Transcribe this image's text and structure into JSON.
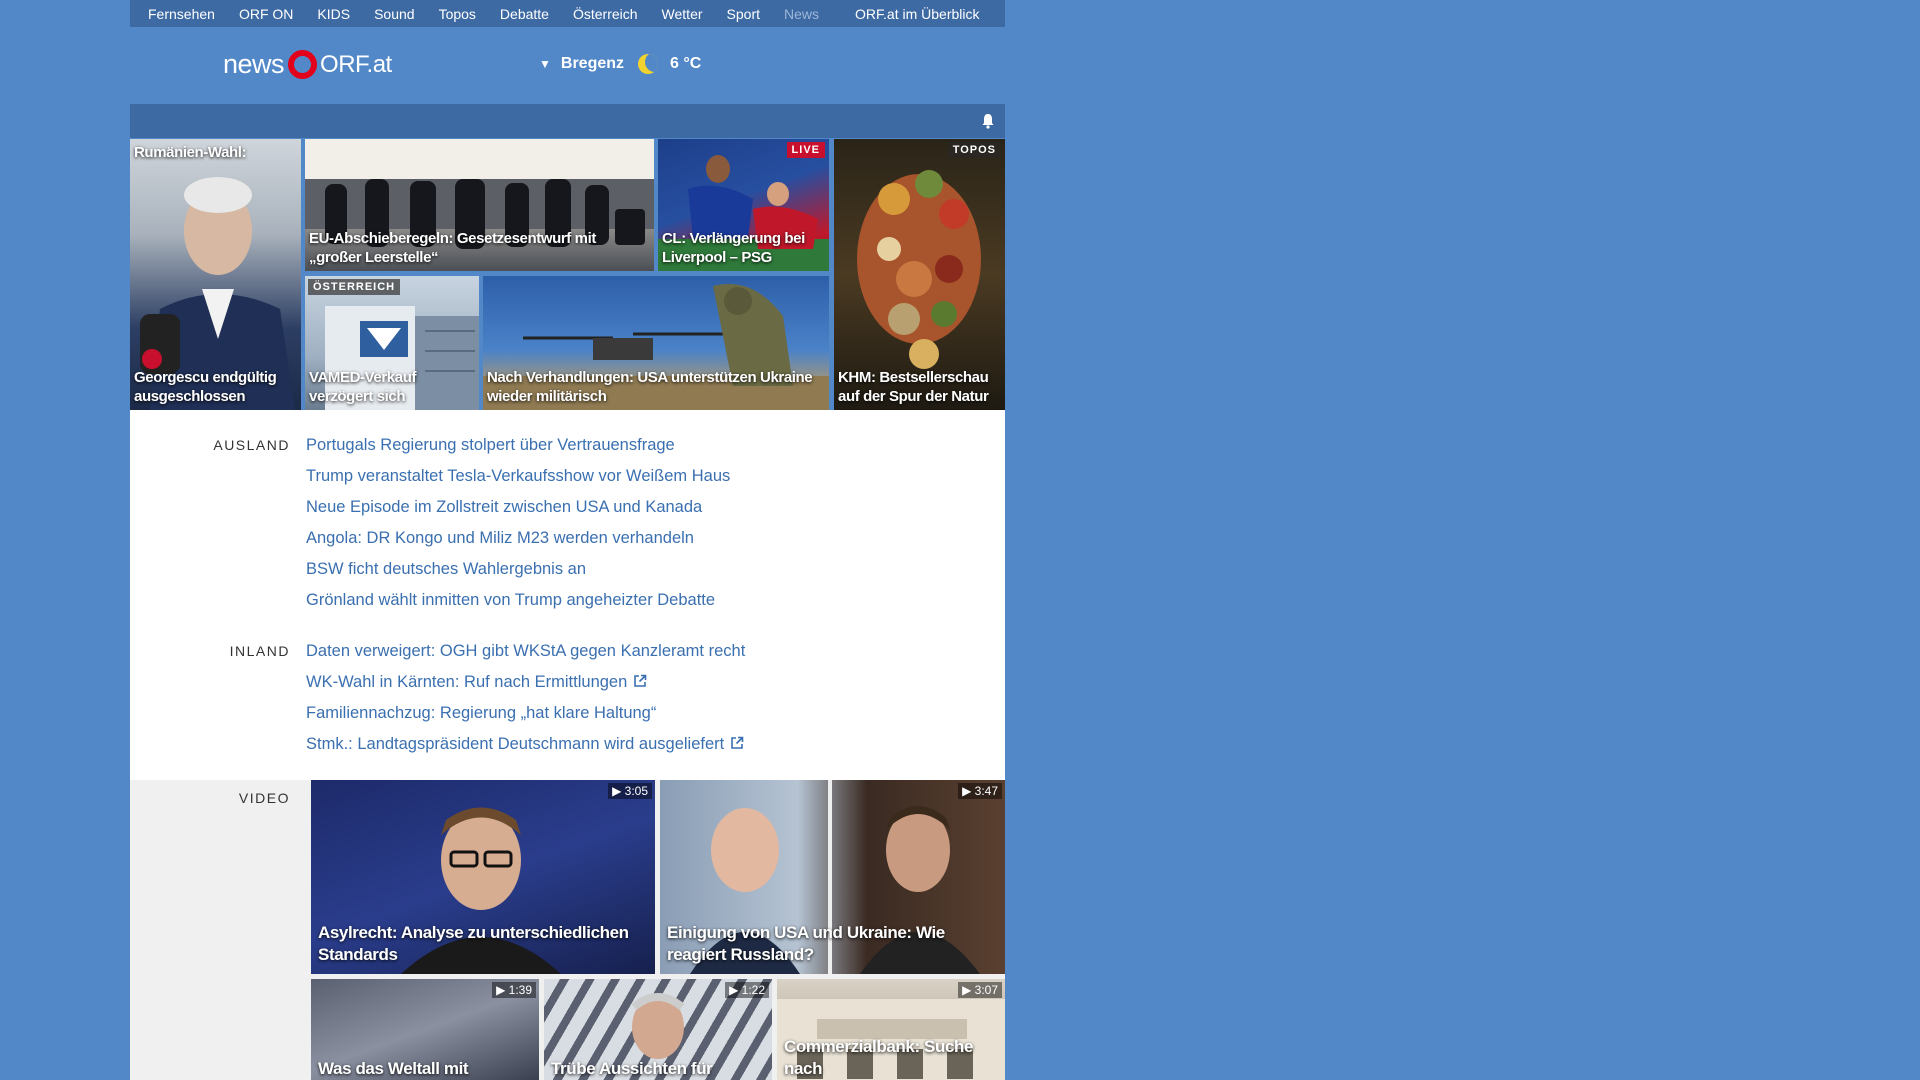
{
  "topnav": {
    "items": [
      "Fernsehen",
      "ORF ON",
      "KIDS",
      "Sound",
      "Topos",
      "Debatte",
      "Österreich",
      "Wetter",
      "Sport",
      "News"
    ],
    "overview": "ORF.at im Überblick"
  },
  "header": {
    "logo_news": "news",
    "logo_orf": "ORF.at",
    "weather": {
      "location": "Bregenz",
      "temperature": "6 °C",
      "icon": "moon-icon"
    }
  },
  "teasers": {
    "rumaenien": {
      "kicker": "Rumänien-Wahl:",
      "title": "Georgescu endgültig ausgeschlossen"
    },
    "eu": {
      "title": "EU-Abschieberegeln: Gesetzesentwurf mit „großer Leerstelle“"
    },
    "cl": {
      "badge": "LIVE",
      "title": "CL: Verlängerung bei Liverpool – PSG"
    },
    "khm": {
      "badge": "TOPOS",
      "title": "KHM: Bestsellerschau auf der Spur der Natur"
    },
    "vamed": {
      "badge": "ÖSTERREICH",
      "title": "VAMED-Verkauf verzögert sich"
    },
    "ukraine": {
      "title": "Nach Verhandlungen: USA unterstützen Ukraine wieder militärisch"
    }
  },
  "ausland": {
    "label": "AUSLAND",
    "links": [
      "Portugals Regierung stolpert über Vertrauensfrage",
      "Trump veranstaltet Tesla-Verkaufsshow vor Weißem Haus",
      "Neue Episode im Zollstreit zwischen USA und Kanada",
      "Angola: DR Kongo und Miliz M23 werden verhandeln",
      "BSW ficht deutsches Wahlergebnis an",
      "Grönland wählt inmitten von Trump angeheizter Debatte"
    ]
  },
  "inland": {
    "label": "INLAND",
    "links": [
      "Daten verweigert: OGH gibt WKStA gegen Kanzleramt recht",
      "WK-Wahl in Kärnten: Ruf nach Ermittlungen",
      "Familiennachzug: Regierung „hat klare Haltung“",
      "Stmk.: Landtagspräsident Deutschmann wird ausgeliefert"
    ]
  },
  "video": {
    "label": "VIDEO",
    "items": [
      {
        "title": "Asylrecht: Analyse zu unterschiedlichen Standards",
        "duration": "3:05"
      },
      {
        "title": "Einigung von USA und Ukraine: Wie reagiert Russland?",
        "duration": "3:47"
      },
      {
        "title": "Was das Weltall mit",
        "duration": "1:39"
      },
      {
        "title": "Trübe Aussichten für",
        "duration": "1:22"
      },
      {
        "title": "Commerzialbank: Suche nach",
        "duration": "3:07"
      }
    ]
  },
  "colors": {
    "background": "#5288c7",
    "nav": "#3d6aa3",
    "link": "#3a6fb0",
    "live": "#c8102e",
    "logo_red": "#e2001a"
  }
}
